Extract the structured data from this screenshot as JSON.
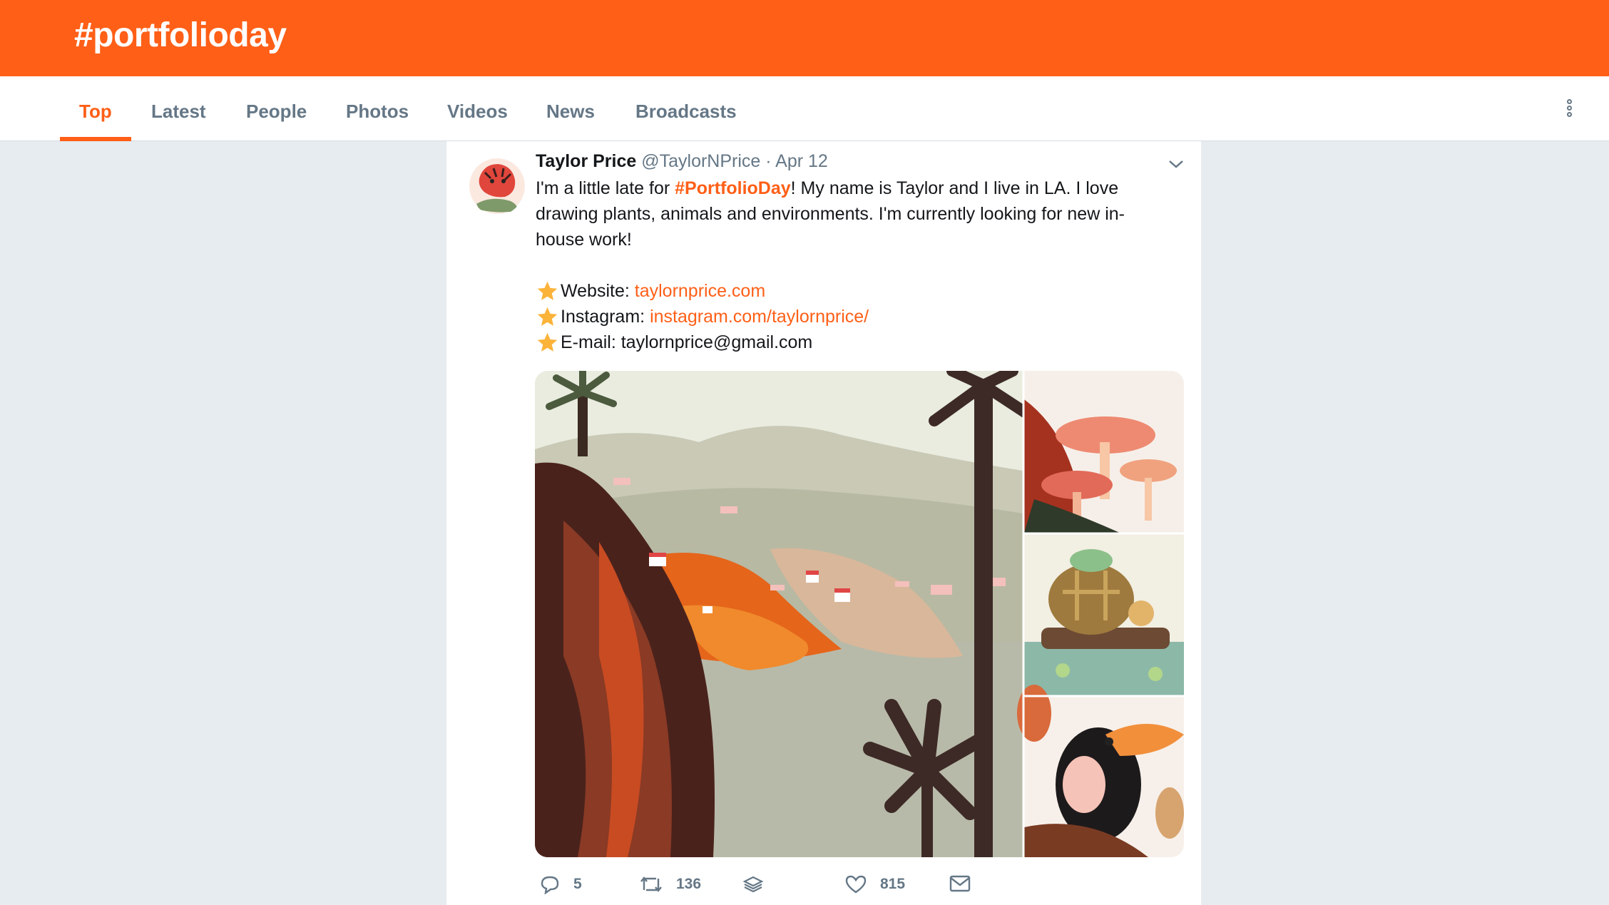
{
  "header": {
    "title": "#portfolioday"
  },
  "tabs": [
    {
      "label": "Top",
      "active": true
    },
    {
      "label": "Latest"
    },
    {
      "label": "People"
    },
    {
      "label": "Photos"
    },
    {
      "label": "Videos"
    },
    {
      "label": "News"
    },
    {
      "label": "Broadcasts"
    }
  ],
  "tweet": {
    "name": "Taylor Price",
    "handle": "@TaylorNPrice",
    "sep": " · ",
    "date": "Apr 12",
    "text_pre": "I'm a little late for ",
    "hashtag": "#PortfolioDay",
    "text_post": "! My name is Taylor and I live in LA. I love drawing plants, animals and environments. I'm currently looking for new in-house work!",
    "website_label": "Website: ",
    "website_link": "taylornprice.com",
    "instagram_label": "Instagram: ",
    "instagram_link": "instagram.com/taylornprice/",
    "email_label": "E-mail: taylornprice@gmail.com",
    "replies": "5",
    "retweets": "136",
    "likes": "815"
  },
  "colors": {
    "accent": "#ff5f17",
    "muted": "#657786",
    "background": "#e6ecf0"
  },
  "icons": [
    "more-vertical-icon",
    "chevron-down-icon",
    "star-icon",
    "reply-icon",
    "retweet-icon",
    "stack-icon",
    "heart-icon",
    "envelope-icon"
  ]
}
